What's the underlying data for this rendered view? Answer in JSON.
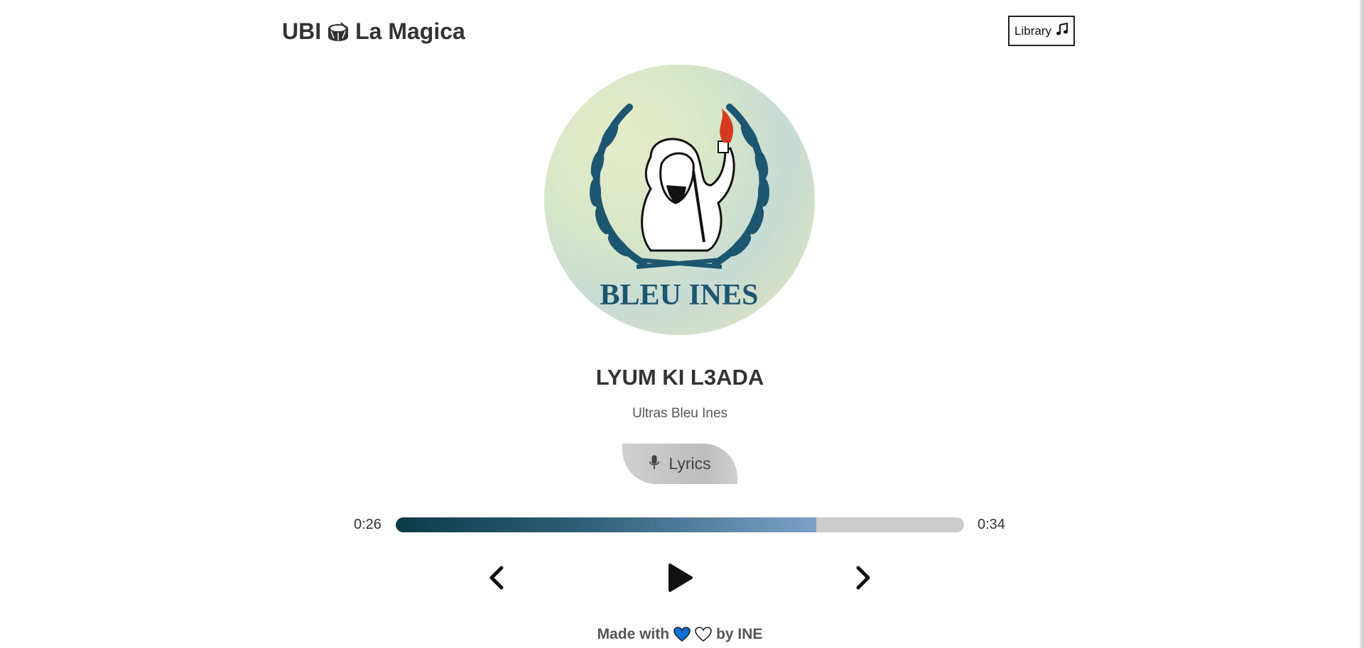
{
  "header": {
    "brand_prefix": "UBI",
    "brand_suffix": "La Magica",
    "brand_icon": "drum-icon",
    "library_label": "Library",
    "library_icon": "music-note-icon"
  },
  "track": {
    "cover_text": "BLEU INES",
    "title": "LYUM KI L3ADA",
    "artist": "Ultras Bleu Ines",
    "lyrics_label": "Lyrics",
    "lyrics_icon": "microphone-icon"
  },
  "player": {
    "current_time": "0:26",
    "total_time": "0:34",
    "progress_fraction": 0.74,
    "progress_colors": [
      "#0c3b47",
      "#7ba1c6"
    ],
    "prev_icon": "chevron-left-icon",
    "play_icon": "play-icon",
    "next_icon": "chevron-right-icon"
  },
  "footer": {
    "made_with": "Made with",
    "by": "by INE",
    "heart_colors": [
      "#0a6fd6",
      "#ffffff"
    ]
  }
}
